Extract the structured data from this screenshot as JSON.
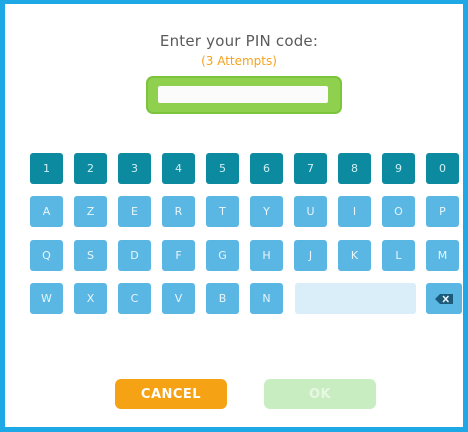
{
  "header": {
    "prompt": "Enter your PIN code:",
    "attempts": "(3 Attempts)"
  },
  "pin": {
    "value": "",
    "placeholder": ""
  },
  "keyboard": {
    "numbers": [
      "1",
      "2",
      "3",
      "4",
      "5",
      "6",
      "7",
      "8",
      "9",
      "0"
    ],
    "row1": [
      "A",
      "Z",
      "E",
      "R",
      "T",
      "Y",
      "U",
      "I",
      "O",
      "P"
    ],
    "row2": [
      "Q",
      "S",
      "D",
      "F",
      "G",
      "H",
      "J",
      "K",
      "L",
      "M"
    ],
    "row3": [
      "W",
      "X",
      "C",
      "V",
      "B",
      "N"
    ]
  },
  "actions": {
    "cancel_label": "CANCEL",
    "ok_label": "OK"
  },
  "colors": {
    "frame": "#1ea8e6",
    "number_key": "#0c8ba0",
    "letter_key": "#5ab7e4",
    "pin_highlight": "#8fd14f",
    "attempts_text": "#f4a31e",
    "cancel_button": "#f5a214",
    "ok_button_disabled": "#c8edc1"
  }
}
